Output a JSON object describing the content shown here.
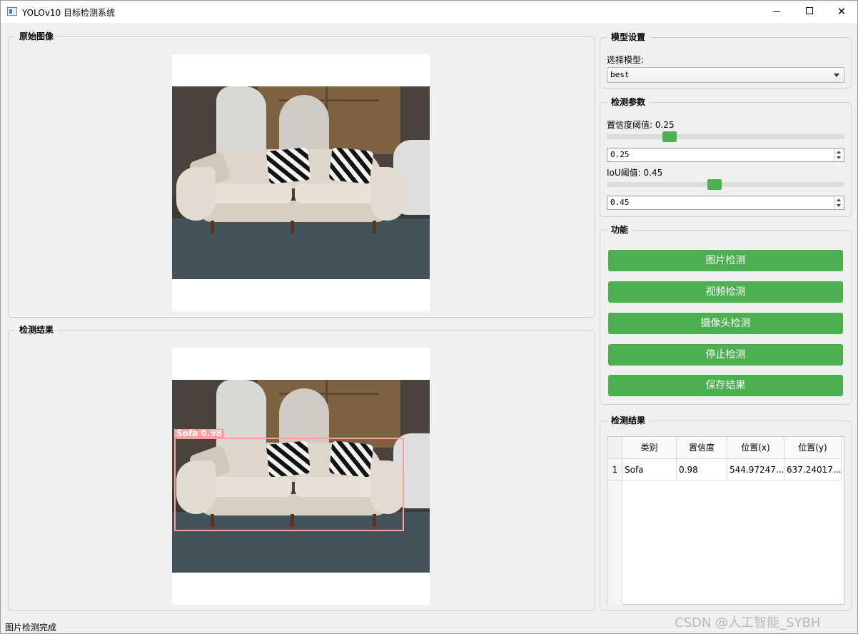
{
  "window": {
    "title": "YOLOv10 目标检测系统",
    "minimize_icon": "minimize-icon",
    "maximize_icon": "maximize-icon",
    "close_label": "✕"
  },
  "original_panel": {
    "title": "原始图像"
  },
  "result_panel": {
    "title": "检测结果",
    "detection_label": "Sofa  0.98",
    "box_color": "#ff9e9e"
  },
  "model_settings": {
    "title": "模型设置",
    "select_label": "选择模型:",
    "selected_model": "best"
  },
  "detect_params": {
    "title": "检测参数",
    "conf_label": "置信度阈值: 0.25",
    "conf_value": "0.25",
    "conf_level": 0.25,
    "iou_label": "IoU阈值: 0.45",
    "iou_value": "0.45",
    "iou_level": 0.45
  },
  "functions": {
    "title": "功能",
    "buttons": [
      "图片检测",
      "视频检测",
      "摄像头检测",
      "停止检测",
      "保存结果"
    ],
    "accent_color": "#4caf50"
  },
  "results_table": {
    "title": "检测结果",
    "columns": [
      "类别",
      "置信度",
      "位置(x)",
      "位置(y)"
    ],
    "rows": [
      {
        "num": "1",
        "class": "Sofa",
        "conf": "0.98",
        "x": "544.97247...",
        "y": "637.24017..."
      }
    ]
  },
  "status": {
    "text": "图片检测完成"
  },
  "watermark": "CSDN @人工智能_SYBH"
}
